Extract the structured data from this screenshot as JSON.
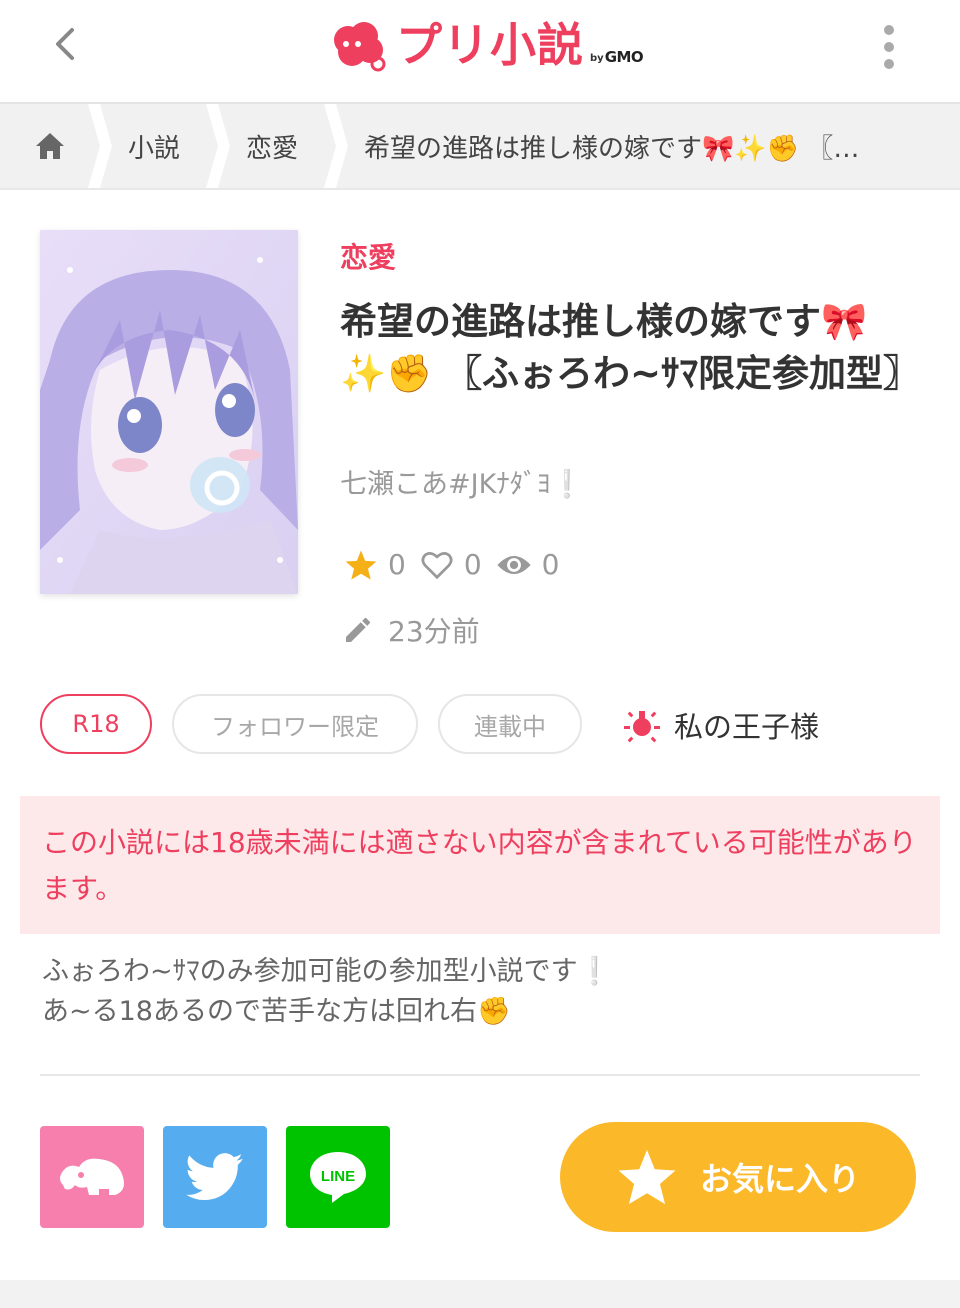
{
  "header": {
    "logo_text": "プリ小説",
    "logo_by": "by",
    "logo_gmo": "GMO",
    "back_icon": "chevron-left-icon",
    "more_icon": "vertical-dots-icon"
  },
  "breadcrumb": {
    "home_icon": "home-icon",
    "items": [
      "小説",
      "恋愛",
      "希望の進路は推し様の嫁です🎀✨✊ 〖…"
    ]
  },
  "book": {
    "genre": "恋愛",
    "title": "希望の進路は推し様の嫁です🎀✨✊ 〖ふぉろわ~ｻﾏ限定参加型〗",
    "author": "七瀬こあ#JKﾅﾀﾞﾖ❕",
    "stats": {
      "stars": "0",
      "likes": "0",
      "views": "0"
    },
    "updated": "23分前"
  },
  "tags": {
    "rating": "R18",
    "follower": "フォロワー限定",
    "status": "連載中",
    "prince": "私の王子様"
  },
  "warning": "この小説には18歳未満には適さない内容が含まれている可能性があります。",
  "description": {
    "line1": "ふぉろわ~ｻﾏのみ参加可能の参加型小説です❕",
    "line2": "あ~る18あるので苦手な方は回れ右✊"
  },
  "share": {
    "line_label": "LINE"
  },
  "favorite_button": "お気に入り",
  "colors": {
    "brand": "#ee3f5f",
    "favorite": "#fbb829",
    "twitter": "#55acee",
    "line": "#00c300",
    "prism": "#f67fae",
    "warning_bg": "#fde8ea"
  }
}
